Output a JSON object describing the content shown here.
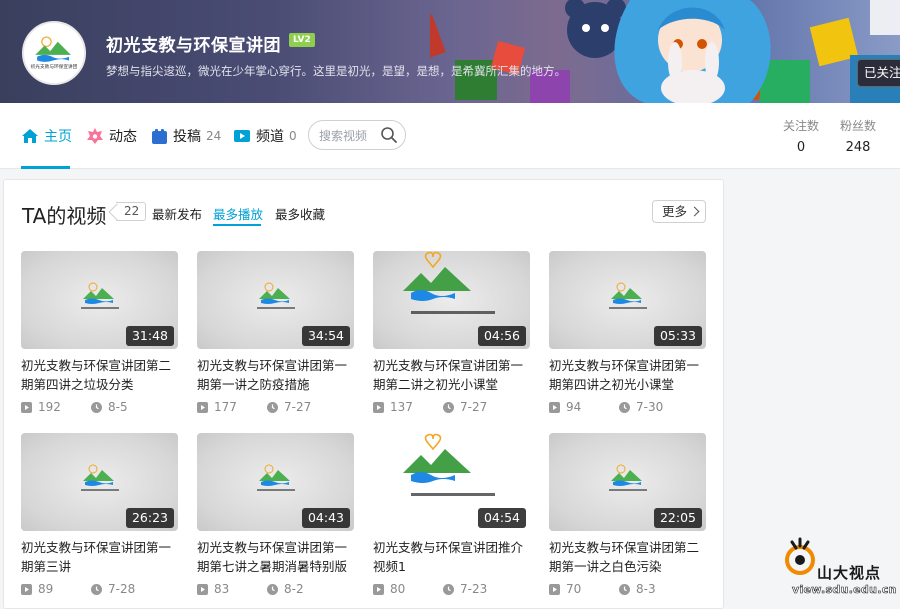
{
  "header": {
    "channel_name": "初光支教与环保宣讲团",
    "level": "LV2",
    "signature": "梦想与指尖逡巡，微光在少年掌心穿行。这里是初光，是望，是想，是希冀所汇集的地方。",
    "follow_button": "已关注",
    "avatar_text": "初光支教与环保宣讲团"
  },
  "nav": {
    "items": [
      {
        "label": "主页",
        "icon": "home-icon",
        "count": ""
      },
      {
        "label": "动态",
        "icon": "activity-icon",
        "count": ""
      },
      {
        "label": "投稿",
        "icon": "upload-icon",
        "count": "24"
      },
      {
        "label": "频道",
        "icon": "channel-icon",
        "count": "0"
      }
    ],
    "active": "主页",
    "search_placeholder": "搜索视频",
    "stats": [
      {
        "label": "关注数",
        "value": "0"
      },
      {
        "label": "粉丝数",
        "value": "248"
      }
    ]
  },
  "videos_section": {
    "title": "TA的视频",
    "count": "22",
    "sort_tabs": [
      "最新发布",
      "最多播放",
      "最多收藏"
    ],
    "active_sort": "最多播放",
    "more_button": "更多",
    "videos": [
      {
        "duration": "31:48",
        "title": "初光支教与环保宣讲团第二期第四讲之垃圾分类",
        "views": "192",
        "date": "8-5",
        "thumb": "small-logo"
      },
      {
        "duration": "34:54",
        "title": "初光支教与环保宣讲团第一期第一讲之防疫措施",
        "views": "177",
        "date": "7-27",
        "thumb": "small-logo"
      },
      {
        "duration": "04:56",
        "title": "初光支教与环保宣讲团第一期第二讲之初光小课堂",
        "views": "137",
        "date": "7-27",
        "thumb": "large-logo"
      },
      {
        "duration": "05:33",
        "title": "初光支教与环保宣讲团第一期第四讲之初光小课堂",
        "views": "94",
        "date": "7-30",
        "thumb": "small-logo"
      },
      {
        "duration": "26:23",
        "title": "初光支教与环保宣讲团第一期第三讲",
        "views": "89",
        "date": "7-28",
        "thumb": "small-logo"
      },
      {
        "duration": "04:43",
        "title": "初光支教与环保宣讲团第一期第七讲之暑期消暑特别版",
        "views": "83",
        "date": "8-2",
        "thumb": "small-logo"
      },
      {
        "duration": "04:54",
        "title": "初光支教与环保宣讲团推介视频1",
        "views": "80",
        "date": "7-23",
        "thumb": "white-large-logo"
      },
      {
        "duration": "22:05",
        "title": "初光支教与环保宣讲团第二期第一讲之白色污染",
        "views": "70",
        "date": "8-3",
        "thumb": "small-logo"
      }
    ]
  },
  "watermark": {
    "name": "山大视点",
    "url": "view.sdu.edu.cn"
  },
  "colors": {
    "accent": "#00a1d6",
    "level_badge": "#8fce4f",
    "logo_green": "#4caf50",
    "logo_blue": "#1e88e5",
    "logo_orange": "#f5a623"
  }
}
